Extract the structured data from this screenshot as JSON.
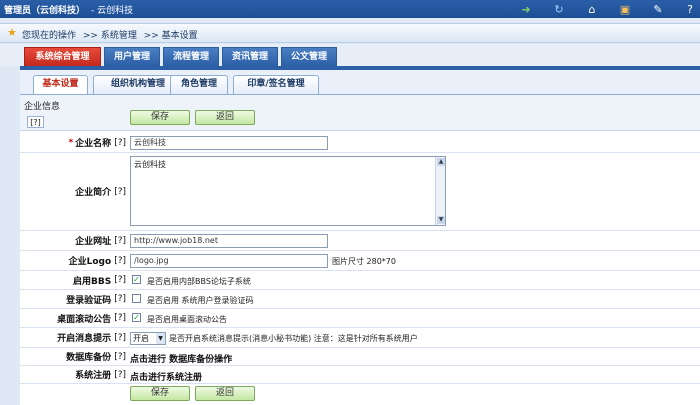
{
  "header": {
    "user": "管理员（云创科技）",
    "separator": "- 云创科技",
    "icons": [
      "exit-icon",
      "refresh-icon",
      "home-icon",
      "contact-icon",
      "note-icon",
      "help-icon"
    ]
  },
  "breadcrumb": {
    "prefix": "您现在的操作",
    "items": [
      ">> 系统管理",
      ">> 基本设置"
    ]
  },
  "main_tabs": [
    "系统综合管理",
    "用户管理",
    "流程管理",
    "资讯管理",
    "公文管理"
  ],
  "sub_tabs": [
    "基本设置",
    "组织机构管理",
    "角色管理",
    "印章/签名管理"
  ],
  "form": {
    "title": "企业信息",
    "help": "[?]",
    "save_label": "保存",
    "back_label": "返回",
    "required_mark": "*",
    "fields": {
      "company_name": {
        "label": "企业名称",
        "help": "[?]",
        "value": "云创科技"
      },
      "company_intro": {
        "label": "企业简介",
        "help": "[?]",
        "value": "云创科技"
      },
      "company_url": {
        "label": "企业网址",
        "help": "[?]",
        "value": "http://www.job18.net"
      },
      "company_logo": {
        "label": "企业Logo",
        "help": "[?]",
        "value": "/logo.jpg",
        "note": "图片尺寸 280*70"
      },
      "enable_bbs": {
        "label": "启用BBS",
        "help": "[?]",
        "checked": true,
        "note": "是否启用内部BBS论坛子系统"
      },
      "login_captcha": {
        "label": "登录验证码",
        "help": "[?]",
        "checked": false,
        "note": "是否启用 系统用户登录验证码"
      },
      "desktop_notice": {
        "label": "桌面滚动公告",
        "help": "[?]",
        "checked": true,
        "note": "是否启用桌面滚动公告"
      },
      "message_alert": {
        "label": "开启消息提示",
        "help": "[?]",
        "selected": "开启",
        "note": "是否开启系统消息提示(消息小秘书功能) 注意：这是针对所有系统用户"
      },
      "db_backup": {
        "label": "数据库备份",
        "help": "[?]",
        "action": "点击进行 数据库备份操作"
      },
      "sys_register": {
        "label": "系统注册",
        "help": "[?]",
        "action": "点击进行系统注册"
      }
    }
  },
  "colors": {
    "header_bg": "#1d4f96",
    "active_main_tab": "#c32a1e",
    "main_tab": "#2c5fa6",
    "button_green": "#c4e7a4"
  }
}
